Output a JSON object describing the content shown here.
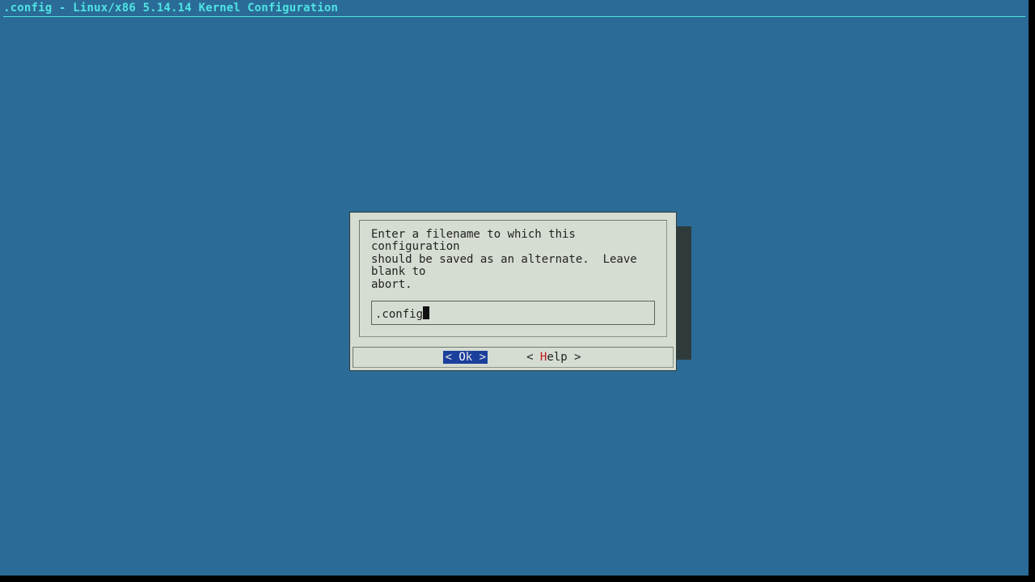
{
  "title": ".config - Linux/x86 5.14.14 Kernel Configuration",
  "dialog": {
    "prompt": "Enter a filename to which this configuration\nshould be saved as an alternate.  Leave blank to\nabort.",
    "input_value": ".config",
    "buttons": {
      "ok": {
        "pre": "<  ",
        "hot": "O",
        "post": "k  >"
      },
      "help": {
        "pre": "< ",
        "hot": "H",
        "post": "elp >"
      }
    }
  }
}
